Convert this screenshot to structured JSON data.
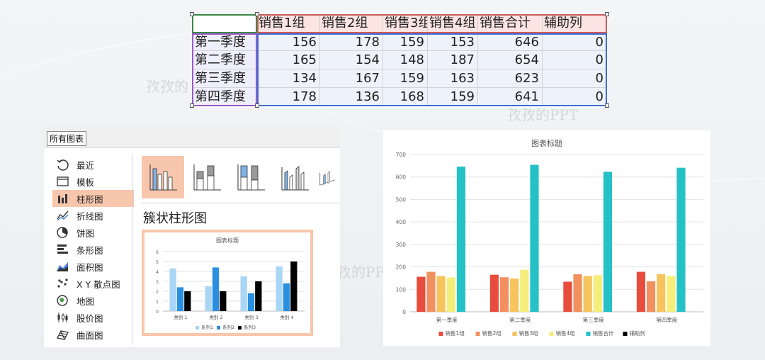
{
  "background": {
    "watermarks": [
      "孜孜的",
      "孜孜的PPT",
      "孜的PPT"
    ]
  },
  "sheet": {
    "header": [
      "",
      "销售1组",
      "销售2组",
      "销售3组",
      "销售4组",
      "销售合计",
      "辅助列"
    ],
    "rows": [
      [
        "第一季度",
        "156",
        "178",
        "159",
        "153",
        "646",
        "0"
      ],
      [
        "第二季度",
        "165",
        "154",
        "148",
        "187",
        "654",
        "0"
      ],
      [
        "第三季度",
        "134",
        "167",
        "159",
        "163",
        "623",
        "0"
      ],
      [
        "第四季度",
        "178",
        "136",
        "168",
        "159",
        "641",
        "0"
      ]
    ]
  },
  "dialog": {
    "tab": "所有图表",
    "types": [
      {
        "label": "最近",
        "icon": "recent-icon"
      },
      {
        "label": "模板",
        "icon": "template-icon"
      },
      {
        "label": "柱形图",
        "icon": "column-chart-icon",
        "selected": true
      },
      {
        "label": "折线图",
        "icon": "line-chart-icon"
      },
      {
        "label": "饼图",
        "icon": "pie-chart-icon"
      },
      {
        "label": "条形图",
        "icon": "bar-chart-icon"
      },
      {
        "label": "面积图",
        "icon": "area-chart-icon"
      },
      {
        "label": "X Y 散点图",
        "icon": "scatter-chart-icon"
      },
      {
        "label": "地图",
        "icon": "map-chart-icon"
      },
      {
        "label": "股价图",
        "icon": "stock-chart-icon"
      },
      {
        "label": "曲面图",
        "icon": "surface-chart-icon"
      }
    ],
    "subtypes": [
      "clustered-column-icon",
      "stacked-column-icon",
      "percent-stacked-column-icon",
      "3d-clustered-column-icon",
      "3d-column-icon"
    ],
    "subtype_name": "簇状柱形图"
  },
  "colors": {
    "selection_fill": "#f7c6ad",
    "series": [
      "#e84c3d",
      "#f39060",
      "#f7c35c",
      "#f5ee7a",
      "#24c1c6",
      "#000000"
    ],
    "preview_series": [
      "#a9d6f5",
      "#2b8fe0",
      "#000000"
    ]
  },
  "chart_data": [
    {
      "type": "bar",
      "title": "图表标题",
      "categories": [
        "第一季度",
        "第二季度",
        "第三季度",
        "第四季度"
      ],
      "series": [
        {
          "name": "销售1组",
          "values": [
            156,
            165,
            134,
            178
          ]
        },
        {
          "name": "销售2组",
          "values": [
            178,
            154,
            167,
            136
          ]
        },
        {
          "name": "销售3组",
          "values": [
            159,
            148,
            159,
            168
          ]
        },
        {
          "name": "销售4组",
          "values": [
            153,
            187,
            163,
            159
          ]
        },
        {
          "name": "销售合计",
          "values": [
            646,
            654,
            623,
            641
          ]
        },
        {
          "name": "辅助列",
          "values": [
            0,
            0,
            0,
            0
          ]
        }
      ],
      "ylim": [
        0,
        700
      ],
      "yticks": [
        0,
        100,
        200,
        300,
        400,
        500,
        600,
        700
      ],
      "grid": true,
      "legend": "bottom"
    },
    {
      "type": "bar",
      "title": "图表标题",
      "categories": [
        "类别 1",
        "类别 2",
        "类别 3",
        "类别 4"
      ],
      "series": [
        {
          "name": "系列1",
          "values": [
            4.3,
            2.5,
            3.5,
            4.5
          ]
        },
        {
          "name": "系列2",
          "values": [
            2.4,
            4.4,
            1.8,
            2.8
          ]
        },
        {
          "name": "系列3",
          "values": [
            2,
            2,
            3,
            5
          ]
        }
      ],
      "ylim": [
        0,
        6
      ],
      "yticks": [
        0,
        1,
        2,
        3,
        4,
        5,
        6
      ],
      "grid": true,
      "legend": "bottom"
    }
  ]
}
